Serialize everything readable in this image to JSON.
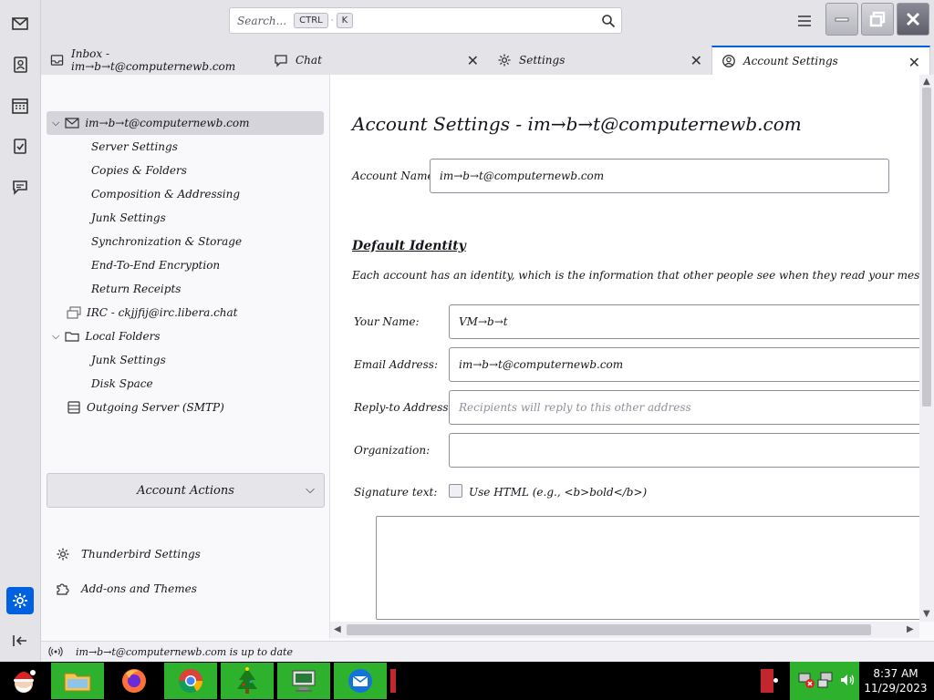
{
  "titlebar": {
    "search_placeholder": "Search...",
    "search_key1": "CTRL",
    "search_key2": "K"
  },
  "tabs": [
    {
      "label": "Inbox - im→b→t@computernewb.com",
      "icon": "inbox-icon",
      "closable": false
    },
    {
      "label": "Chat",
      "icon": "chat-icon",
      "closable": true
    },
    {
      "label": "Settings",
      "icon": "gear-icon",
      "closable": true
    },
    {
      "label": "Account Settings",
      "icon": "account-icon",
      "closable": true,
      "active": true
    }
  ],
  "folders": {
    "account": "im→b→t@computernewb.com",
    "sub_items": [
      "Server Settings",
      "Copies & Folders",
      "Composition & Addressing",
      "Junk Settings",
      "Synchronization & Storage",
      "End-To-End Encryption",
      "Return Receipts"
    ],
    "irc": "IRC - ckjjfij@irc.libera.chat",
    "local_folders": "Local Folders",
    "local_items": [
      "Junk Settings",
      "Disk Space"
    ],
    "outgoing": "Outgoing Server (SMTP)",
    "account_actions": "Account Actions",
    "thunderbird_settings": "Thunderbird Settings",
    "addons": "Add-ons and Themes"
  },
  "content": {
    "title": "Account Settings - im→b→t@computernewb.com",
    "account_name_label": "Account Name:",
    "account_name_value": "im→b→t@computernewb.com",
    "identity_heading": "Default Identity",
    "identity_desc": "Each account has an identity, which is the information that other people see when they read your messages.",
    "your_name_label": "Your Name:",
    "your_name_value": "VM→b→t",
    "email_label": "Email Address:",
    "email_value": "im→b→t@computernewb.com",
    "reply_label": "Reply-to Address:",
    "reply_placeholder": "Recipients will reply to this other address",
    "org_label": "Organization:",
    "sig_label": "Signature text:",
    "use_html_label": "Use HTML (e.g., <b>bold</b>)"
  },
  "status": {
    "text": "im→b→t@computernewb.com is up to date"
  },
  "taskbar": {
    "time": "8:37 AM",
    "date": "11/29/2023"
  },
  "colors": {
    "accent": "#0061e0",
    "taskbar_green": "#2eb22e"
  }
}
